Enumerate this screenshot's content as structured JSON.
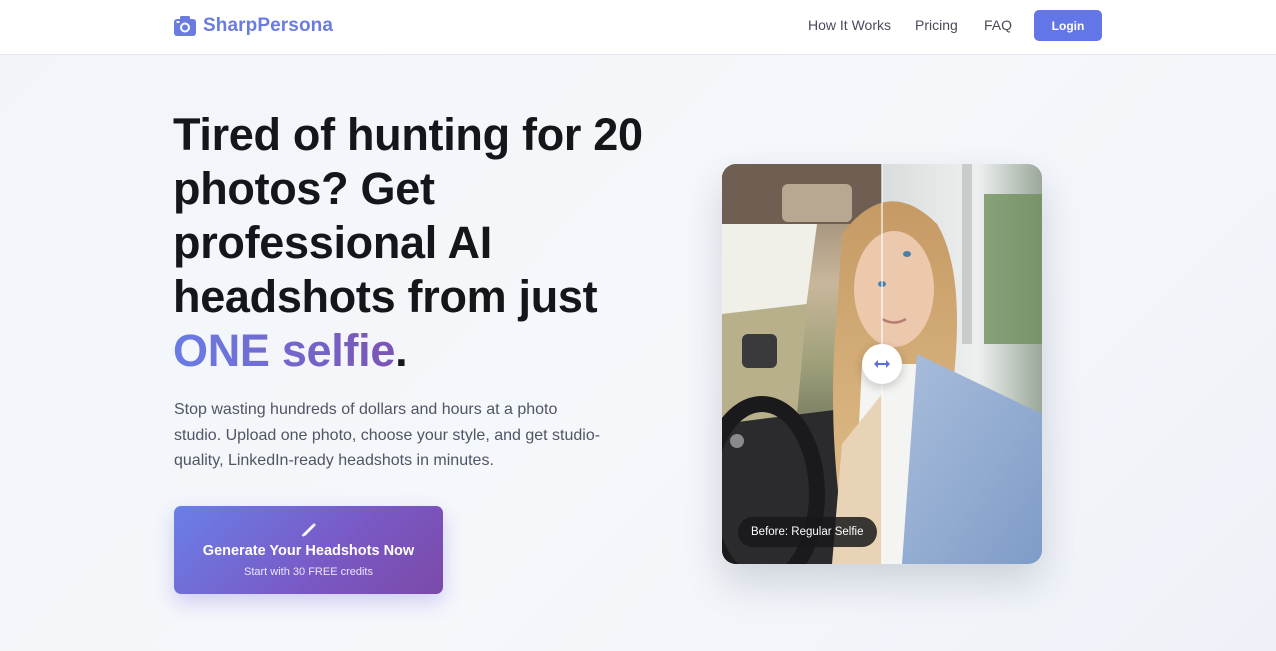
{
  "header": {
    "brand_name": "SharpPersona",
    "brand_icon": "camera-icon",
    "brand_color": "#6a7ce0",
    "nav": [
      {
        "label": "How It Works"
      },
      {
        "label": "Pricing"
      },
      {
        "label": "FAQ"
      }
    ],
    "login_label": "Login"
  },
  "hero": {
    "headline_part1": "Tired of hunting for 20 photos? Get professional AI headshots from just ",
    "headline_accent": "ONE selfie",
    "headline_end": ".",
    "subtext": "Stop wasting hundreds of dollars and hours at a photo studio. Upload one photo, choose your style, and get studio-quality, LinkedIn-ready headshots in minutes.",
    "cta": {
      "icon": "wand-icon",
      "title": "Generate Your Headshots Now",
      "subtitle": "Start with 30 FREE credits"
    }
  },
  "comparison": {
    "slider_icon": "arrows-horizontal-icon",
    "before_label": "Before: Regular Selfie"
  },
  "colors": {
    "accent": "#6376e8",
    "accent_gradient_end": "#7a55b4",
    "headline": "#15161a",
    "body_text": "#4f5563"
  }
}
